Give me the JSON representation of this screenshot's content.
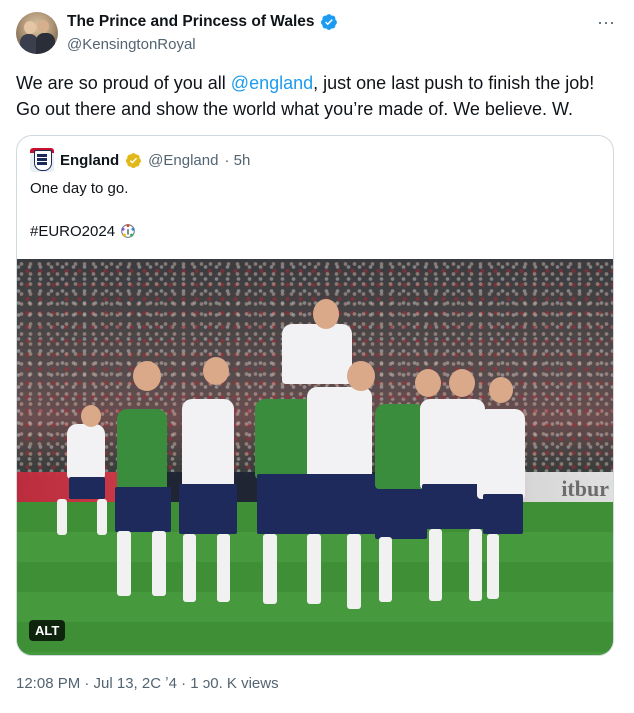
{
  "author": {
    "display_name": "The Prince and Princess of Wales",
    "handle": "@KensingtonRoyal"
  },
  "tweet": {
    "text_before": "We are so proud of you all ",
    "mention": "@england",
    "text_after": ", just one last push to finish the job! Go out there and show the world what you’re made of. We believe. W."
  },
  "quote": {
    "name": "England",
    "handle": "@England",
    "time": "· 5h",
    "text": "One day to go.",
    "hashtag": "#EURO2024",
    "alt_label": "ALT"
  },
  "meta": {
    "text": "12:08 PM · Jul 13, 2C ʼ4 · 1 ɔ0. K views"
  },
  "colors": {
    "link": "#1d9bf0",
    "verified_blue": "#1d9bf0",
    "verified_gold": "#e2b719",
    "secondary_text": "#536471"
  },
  "icons": [
    "avatar",
    "verified-icon",
    "more-icon",
    "england-logo",
    "gold-verified-icon",
    "euro-trophy-icon"
  ]
}
